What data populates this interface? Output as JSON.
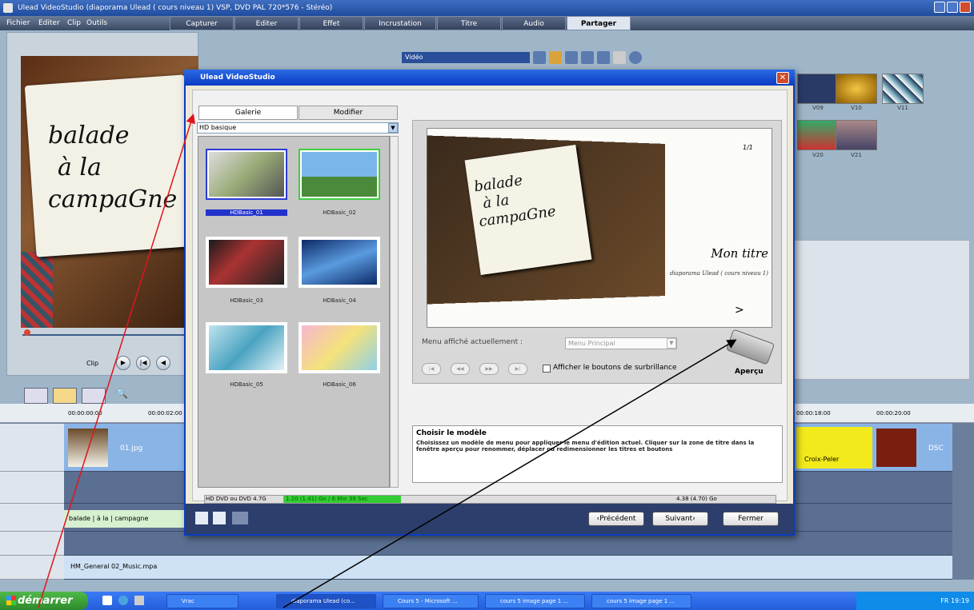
{
  "window": {
    "title": "Ulead VideoStudio (diaporama Ulead ( cours niveau 1) VSP, DVD PAL 720*576 - Stéréo)"
  },
  "menubar": {
    "items": [
      "Fichier",
      "Editer",
      "Clip",
      "Outils"
    ]
  },
  "steps": {
    "tabs": [
      "Capturer",
      "Editer",
      "Effet",
      "Incrustation",
      "Titre",
      "Audio",
      "Partager"
    ],
    "active": "Partager"
  },
  "library": {
    "dropdown": "Vidéo",
    "thumbs": [
      {
        "label": "V09"
      },
      {
        "label": "V10"
      },
      {
        "label": "V11"
      },
      {
        "label": "V20"
      },
      {
        "label": "V21"
      }
    ]
  },
  "preview": {
    "card_lines": [
      "balade",
      "à la",
      "campaGne"
    ],
    "clip_label": "Clip"
  },
  "timeline": {
    "times": [
      "00:00:00:00",
      "00:00:02:00",
      "00:00:18:00",
      "00:00:20:00"
    ],
    "clip_name": "01.jpg",
    "title_track": "balade | à la | campagne",
    "music_track": "HM_General 02_Music.mpa",
    "clip_label_right": "Croix-Peler",
    "dsc_label": "DSC"
  },
  "dialog": {
    "title": "Ulead VideoStudio",
    "tabs": [
      "Galerie",
      "Modifier"
    ],
    "gallery_select": "HD basique",
    "items": [
      {
        "label": "HDBasic_01"
      },
      {
        "label": "HDBasic_02"
      },
      {
        "label": "HDBasic_03"
      },
      {
        "label": "HDBasic_04"
      },
      {
        "label": "HDBasic_05"
      },
      {
        "label": "HDBasic_06"
      }
    ],
    "preview": {
      "book_lines": [
        "balade",
        "à la",
        "campaGne"
      ],
      "title": "Mon titre",
      "subtitle": "diaporama Ulead ( cours niveau 1)",
      "page": "1/1",
      "next": ">"
    },
    "menu_label": "Menu affiché actuellement :",
    "menu_value": "Menu Principal",
    "nav_buttons": [
      "|◀",
      "◀◀",
      "▶▶",
      "▶|"
    ],
    "checkbox_label": "Afficher le boutons de surbrillance",
    "apercu": "Aperçu",
    "info": {
      "title": "Choisir le modèle",
      "text": "Choisissez un modèle de menu pour appliquer le menu d'édition actuel. Cliquer sur la zone de titre dans la fenêtre aperçu pour renommer, déplacer ou redimensionner les titres et boutons"
    },
    "disc": {
      "type": "HD DVD ou DVD 4.7G",
      "used": "1.20 (1.41) Go / 6 Min 39 Sec",
      "size": "4.38 (4.70) Go"
    },
    "buttons": {
      "prev": "‹Précédent",
      "next": "Suivant›",
      "close": "Fermer"
    }
  },
  "taskbar": {
    "start": "démarrer",
    "tasks": [
      "Vrac",
      "diaporama Ulead (co...",
      "Cours 5 - Microsoft ...",
      "cours 5 image page 1 ...",
      "cours 5 image page 1 ..."
    ],
    "clock": "FR 19:19"
  },
  "colors": {
    "accent": "#0a3cc2",
    "selection": "#2b3bd4",
    "progress": "#33cc33"
  }
}
